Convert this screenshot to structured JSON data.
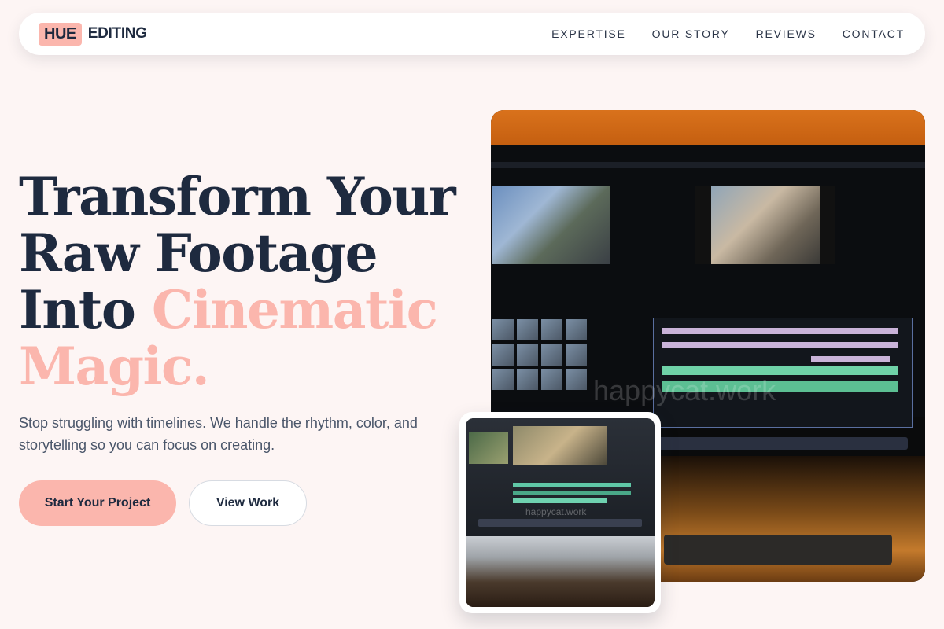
{
  "brand": {
    "logo_box": "HUE",
    "logo_text": "EDITING",
    "accent_color": "#fbb6ad",
    "text_color": "#1e2a3f"
  },
  "nav": {
    "links": [
      {
        "label": "EXPERTISE"
      },
      {
        "label": "OUR STORY"
      },
      {
        "label": "REVIEWS"
      },
      {
        "label": "CONTACT"
      }
    ]
  },
  "hero": {
    "headline_line1": "Transform Your",
    "headline_line2": "Raw Footage",
    "headline_line3_start": "Into ",
    "headline_accent_1": "Cinematic",
    "headline_accent_2": "Magic.",
    "subtitle": "Stop struggling with timelines. We handle the rhythm, color, and storytelling so you can focus on creating.",
    "primary_cta": "Start Your Project",
    "secondary_cta": "View Work"
  },
  "media": {
    "main_watermark": "happycat.work",
    "inset_watermark": "happycat.work"
  }
}
